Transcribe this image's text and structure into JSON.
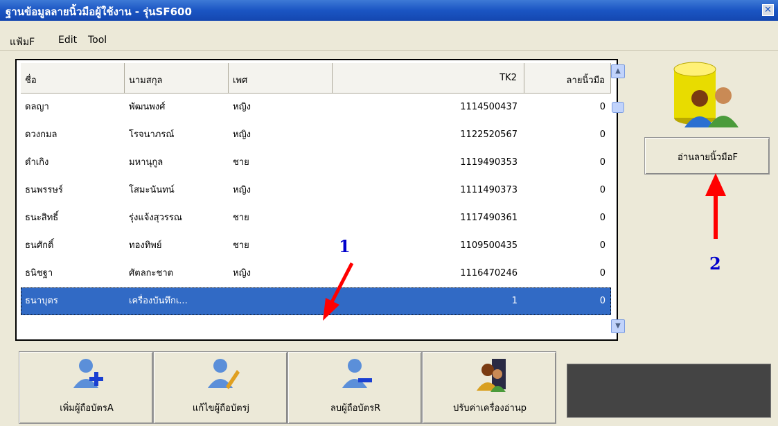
{
  "window": {
    "title": "ฐานข้อมูลลายนิ้วมือผู้ใช้งาน - รุ่นSF600"
  },
  "menu": [
    "แฟ้มF",
    "Edit",
    "Tool"
  ],
  "columns": [
    "ชื่อ",
    "นามสกุล",
    "เพศ",
    "TK2",
    "ลายนิ้วมือ"
  ],
  "rows": [
    {
      "first": "ดลญา",
      "last": "พัฒนพงศ์",
      "sex": "หญิง",
      "tk2": "1114500437",
      "fp": "0"
    },
    {
      "first": "ดวงกมล",
      "last": "โรจนาภรณ์",
      "sex": "หญิง",
      "tk2": "1122520567",
      "fp": "0"
    },
    {
      "first": "ดำเกิง",
      "last": "มหานุกูล",
      "sex": "ชาย",
      "tk2": "1119490353",
      "fp": "0"
    },
    {
      "first": "ธนพรรษร์",
      "last": "โสมะนันทน์",
      "sex": "หญิง",
      "tk2": "1111490373",
      "fp": "0"
    },
    {
      "first": "ธนะสิทธิ์",
      "last": "รุ่งแจ้งสุวรรณ",
      "sex": "ชาย",
      "tk2": "1117490361",
      "fp": "0"
    },
    {
      "first": "ธนศักดิ์",
      "last": "ทองทิพย์",
      "sex": "ชาย",
      "tk2": "1109500435",
      "fp": "0"
    },
    {
      "first": "ธนิชฐา",
      "last": "ศัตลกะชาต",
      "sex": "หญิง",
      "tk2": "1116470246",
      "fp": "0"
    },
    {
      "first": "ธนาบุตร",
      "last": "เครื่องบันทึกเ...",
      "sex": "",
      "tk2": "1",
      "fp": "0"
    }
  ],
  "read_button": "อ่านลายนิ้วมือF",
  "buttons": {
    "add": "เพิ่มผู้ถือบัตรA",
    "edit": "แก้ไขผู้ถือบัตรj",
    "delete": "ลบผู้ถือบัตรR",
    "config": "ปรับค่าเครื่องอ่านp"
  },
  "annotations": {
    "one": "1",
    "two": "2"
  }
}
